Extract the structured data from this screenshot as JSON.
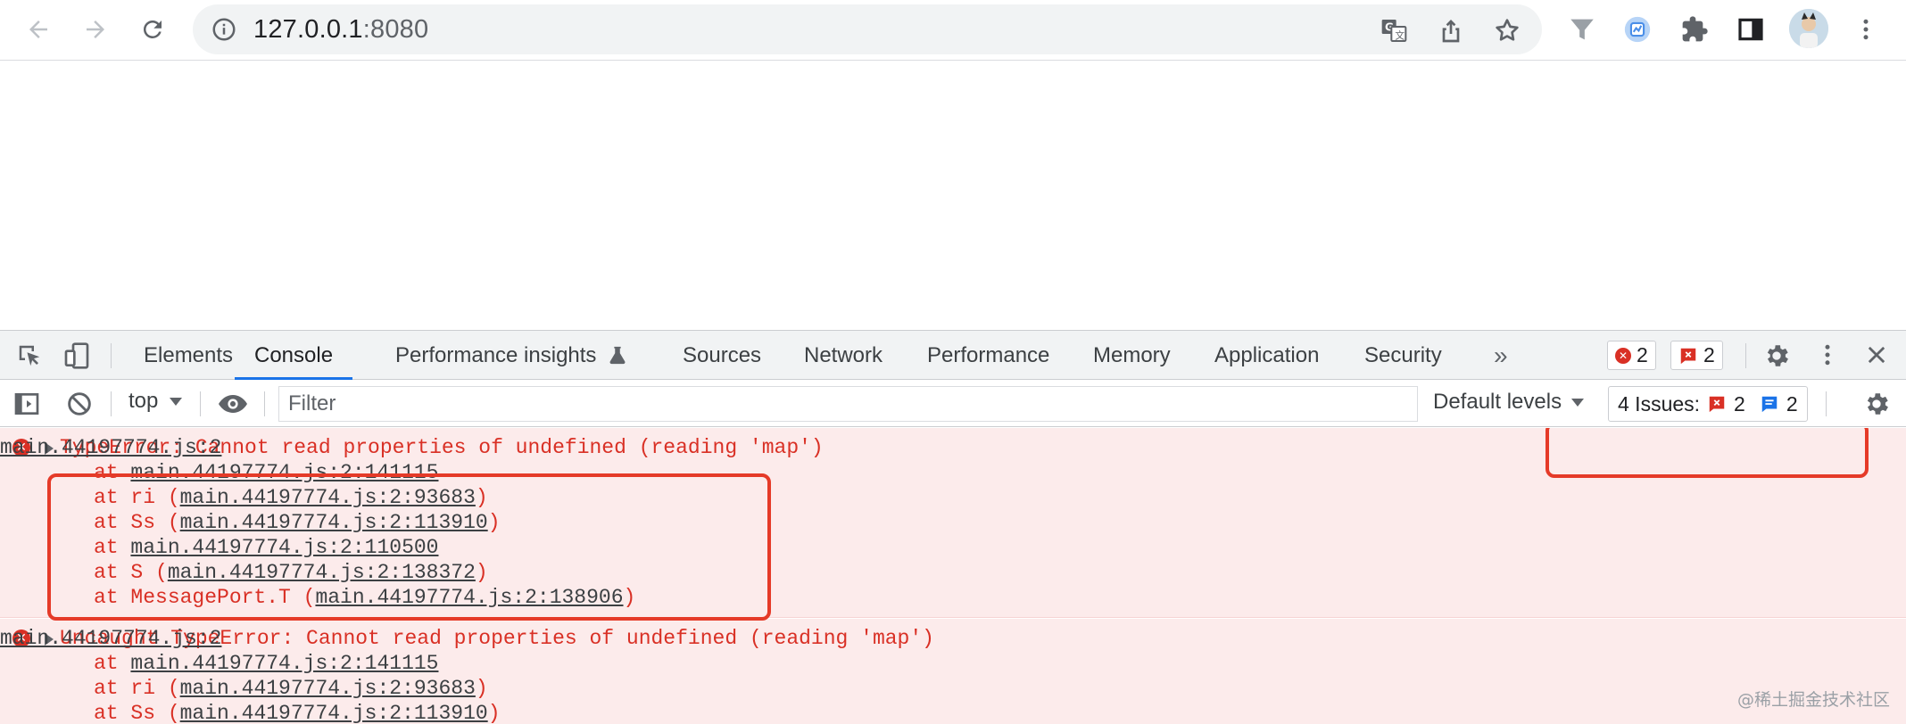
{
  "browser": {
    "url_host": "127.0.0.1",
    "url_port": ":8080",
    "icons": [
      "back-arrow-icon",
      "forward-arrow-icon",
      "reload-icon",
      "info-icon",
      "translate-icon",
      "share-icon",
      "bookmark-star-icon",
      "filter-extension-icon",
      "extension-icon",
      "puzzle-icon",
      "side-panel-icon",
      "avatar",
      "kebab-menu-icon"
    ]
  },
  "devtools": {
    "tabs": [
      {
        "label": "Elements"
      },
      {
        "label": "Console"
      },
      {
        "label": "Performance insights"
      },
      {
        "label": "Sources"
      },
      {
        "label": "Network"
      },
      {
        "label": "Performance"
      },
      {
        "label": "Memory"
      },
      {
        "label": "Application"
      },
      {
        "label": "Security"
      }
    ],
    "more_tabs": "»",
    "error_count": "2",
    "issue_count": "2",
    "filter_bar": {
      "context": "top",
      "filter_placeholder": "Filter",
      "levels": "Default levels",
      "issues_label": "4 Issues:",
      "issues_errors": "2",
      "issues_info": "2"
    }
  },
  "console": {
    "entries": [
      {
        "message": "TypeError: Cannot read properties of undefined (reading 'map')",
        "source": "main.44197774.js:2",
        "stack": [
          {
            "prefix": "at ",
            "link": "main.44197774.js:2:141115",
            "suffix": ""
          },
          {
            "prefix": "at ri (",
            "link": "main.44197774.js:2:93683",
            "suffix": ")"
          },
          {
            "prefix": "at Ss (",
            "link": "main.44197774.js:2:113910",
            "suffix": ")"
          },
          {
            "prefix": "at ",
            "link": "main.44197774.js:2:110500",
            "suffix": ""
          },
          {
            "prefix": "at S (",
            "link": "main.44197774.js:2:138372",
            "suffix": ")"
          },
          {
            "prefix": "at MessagePort.T (",
            "link": "main.44197774.js:2:138906",
            "suffix": ")"
          }
        ]
      },
      {
        "message": "Uncaught TypeError: Cannot read properties of undefined (reading 'map')",
        "source": "main.44197774.js:2",
        "stack": [
          {
            "prefix": "at ",
            "link": "main.44197774.js:2:141115",
            "suffix": ""
          },
          {
            "prefix": "at ri (",
            "link": "main.44197774.js:2:93683",
            "suffix": ")"
          },
          {
            "prefix": "at Ss (",
            "link": "main.44197774.js:2:113910",
            "suffix": ")"
          }
        ]
      }
    ]
  },
  "watermark": "@稀土掘金技术社区",
  "colors": {
    "error_red": "#d93025",
    "error_bg": "#fcebeb",
    "active_tab": "#1a73e8",
    "annotation": "#e53a28"
  }
}
